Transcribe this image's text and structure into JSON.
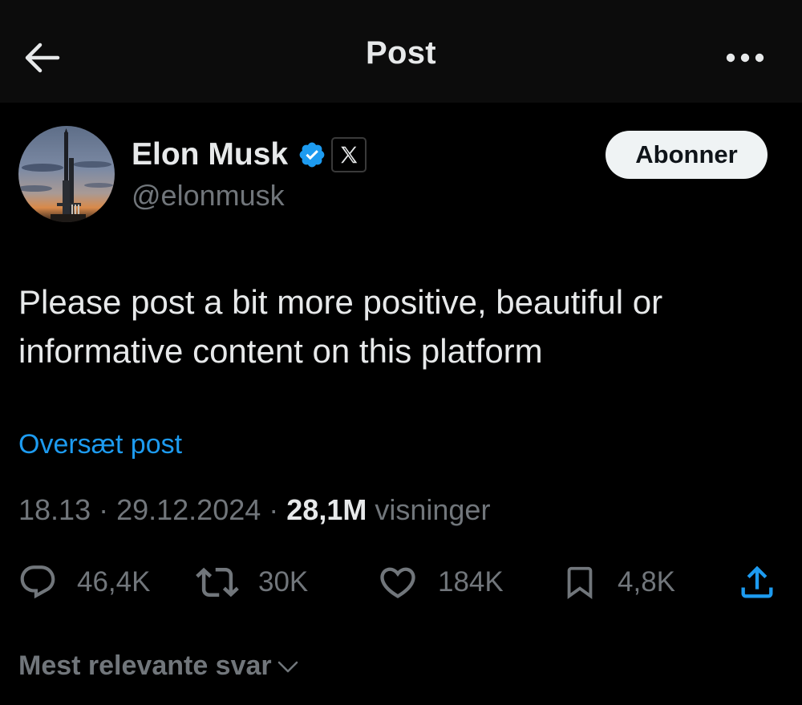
{
  "header": {
    "title": "Post",
    "back_icon": "arrow-left-icon",
    "more_icon": "more-horizontal-icon"
  },
  "author": {
    "name": "Elon Musk",
    "handle": "@elonmusk",
    "verified_icon": "verified-check-icon",
    "affiliate_icon": "x-logo-icon",
    "avatar_icon": "starship-avatar"
  },
  "subscribe_button": {
    "label": "Abonner"
  },
  "post": {
    "text": "Please post a bit more positive, beautiful or informative content on this platform",
    "translate_label": "Oversæt post",
    "time": "18.13",
    "separator": " · ",
    "date": "29.12.2024",
    "views_count": "28,1M",
    "views_label": "visninger"
  },
  "actions": {
    "reply": {
      "icon": "reply-icon",
      "count": "46,4K"
    },
    "repost": {
      "icon": "repost-icon",
      "count": "30K"
    },
    "like": {
      "icon": "heart-icon",
      "count": "184K"
    },
    "bookmark": {
      "icon": "bookmark-icon",
      "count": "4,8K"
    },
    "share": {
      "icon": "share-icon"
    }
  },
  "replies_sort": {
    "label": "Mest relevante svar",
    "icon": "chevron-down-icon"
  },
  "colors": {
    "background": "#000000",
    "header_background": "#0c0c0c",
    "text_primary": "#e7e9ea",
    "text_secondary": "#71767b",
    "accent_blue": "#1d9bf0",
    "button_background": "#eff3f4"
  }
}
